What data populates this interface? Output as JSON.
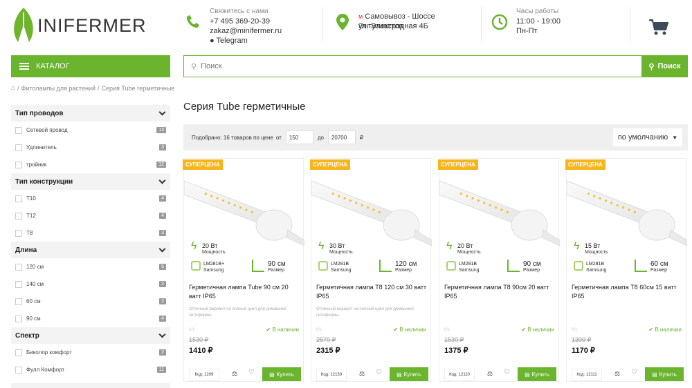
{
  "logo": {
    "text": "MINIFERMER",
    "mark": "M",
    "rest": "INIFERMER"
  },
  "contacts": {
    "title": "Свяжитесь с нами",
    "phone": "+7 495 369-20-39",
    "email": "zakaz@minifermer.ru",
    "telegram": "Telegram"
  },
  "pickup": {
    "line1": "Самовывоз - Шоссе Энтузиастов",
    "line2": "ул. Электродная 4Б"
  },
  "hours": {
    "title": "Часы работы",
    "time": "11:00 - 19:00",
    "days": "Пн-Пт"
  },
  "catalog": {
    "label": "КАТАЛОГ"
  },
  "search": {
    "placeholder": "Поиск",
    "button": "Поиск"
  },
  "breadcrumb": {
    "items": [
      "Фитолампы для растений",
      "Серия Tube герметичные"
    ]
  },
  "sidebar": {
    "groups": [
      {
        "title": "Тип проводов",
        "items": [
          {
            "label": "Сетевой провод",
            "count": "13"
          },
          {
            "label": "Удлинитель",
            "count": "3"
          },
          {
            "label": "тройник",
            "count": "12"
          }
        ]
      },
      {
        "title": "Тип конструкции",
        "items": [
          {
            "label": "T10",
            "count": "4"
          },
          {
            "label": "T12",
            "count": "4"
          },
          {
            "label": "T8",
            "count": "3"
          }
        ]
      },
      {
        "title": "Длина",
        "items": [
          {
            "label": "120 см",
            "count": "5"
          },
          {
            "label": "140 см",
            "count": "2"
          },
          {
            "label": "60 см",
            "count": "2"
          },
          {
            "label": "90 см",
            "count": "4"
          }
        ]
      },
      {
        "title": "Спектр",
        "items": [
          {
            "label": "Биколор комфорт",
            "count": "2"
          },
          {
            "label": "Фулл Комфорт",
            "count": "11"
          }
        ]
      }
    ]
  },
  "page_title": "Серия Tube герметичные",
  "filterbar": {
    "found": "Подобрано: 16 товаров по цене",
    "from": "от",
    "min": "150",
    "to": "до",
    "max": "20700",
    "currency": "₽",
    "sort": "по умолчанию"
  },
  "products": [
    {
      "badge": "СУПЕРЦЕНА",
      "power": "20 Вт",
      "power_label": "Мощность",
      "chip": "LM281B+",
      "chip_brand": "Samsung",
      "size": "90 см",
      "size_label": "Размер",
      "name": "Герметичная лампа Tube 90 см 20 ватт IP65",
      "desc": "Отличный вариант на полный цикл для домашней ситифермы.",
      "zero": "0/1",
      "avail": "В наличии",
      "old": "1530 ₽",
      "price": "1410 ₽",
      "code": "Код: 1209",
      "buy": "Купить"
    },
    {
      "badge": "СУПЕРЦЕНА",
      "power": "30 Вт",
      "power_label": "Мощность",
      "chip": "LM281B",
      "chip_brand": "Samsung",
      "size": "120 см",
      "size_label": "Размер",
      "name": "Герметичная лампа T8 120 см 30 ватт IP65",
      "desc": "Отличный вариант на полный цикл для домашней ситифермы.",
      "zero": "0/1",
      "avail": "В наличии",
      "old": "2570 ₽",
      "price": "2315 ₽",
      "code": "Код: 12130",
      "buy": "Купить"
    },
    {
      "badge": "СУПЕРЦЕНА",
      "power": "20 Вт",
      "power_label": "Мощность",
      "chip": "LM281B",
      "chip_brand": "Samsung",
      "size": "90 см",
      "size_label": "Размер",
      "name": "Герметичная лампа T8 90см 20 ватт IP65",
      "desc": "",
      "zero": "0/1",
      "avail": "В наличии",
      "old": "1530 ₽",
      "price": "1375 ₽",
      "code": "Код: 12110",
      "buy": "Купить"
    },
    {
      "badge": "СУПЕРЦЕНА",
      "power": "15 Вт",
      "power_label": "Мощность",
      "chip": "LM281B",
      "chip_brand": "Samsung",
      "size": "60 см",
      "size_label": "Размер",
      "name": "Герметичная лампа T8 60см 15 ватт IP65",
      "desc": "",
      "zero": "0/1",
      "avail": "В наличии",
      "old": "1300 ₽",
      "price": "1170 ₽",
      "code": "Код: 12111",
      "buy": "Купить"
    }
  ],
  "colors": {
    "accent": "#6ab42e",
    "badge": "#f7b51c"
  }
}
